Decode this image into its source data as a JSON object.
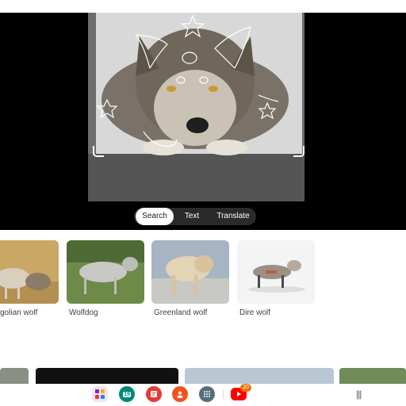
{
  "modes": {
    "search": "Search",
    "text": "Text",
    "translate": "Translate",
    "active": "Search"
  },
  "results": [
    {
      "label": "golian wolf",
      "image": "mongolian-wolf-photo"
    },
    {
      "label": "Wolfdog",
      "image": "wolfdog-photo"
    },
    {
      "label": "Greenland wolf",
      "image": "greenland-wolf-photo"
    },
    {
      "label": "Dire wolf",
      "image": "dire-wolf-illustration"
    }
  ],
  "taskbar": {
    "calendar_day": "19",
    "youtube_badge": "20",
    "apps": [
      "app-folder-icon",
      "calendar-icon",
      "notes-icon",
      "contacts-icon",
      "app-drawer-icon",
      "youtube-icon"
    ],
    "recents_glyph": "|||"
  },
  "colors": {
    "background": "#ffffff",
    "viewer_background": "#000000",
    "badge": "#e8710a",
    "youtube": "#ff0000"
  }
}
